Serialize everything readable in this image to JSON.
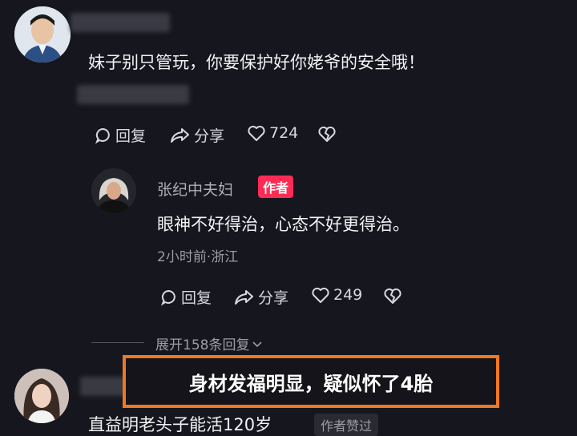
{
  "comment1": {
    "text": "妹子别只管玩，你要保护好你姥爷的安全哦！",
    "actions": {
      "reply": "回复",
      "share": "分享",
      "likes": "724"
    }
  },
  "reply1": {
    "author": "张纪中夫妇",
    "author_badge": "作者",
    "text": "眼神不好得治，心态不好更得治。",
    "meta": "2小时前·浙江",
    "actions": {
      "reply": "回复",
      "share": "分享",
      "likes": "249"
    }
  },
  "expand_replies": "展开158条回复",
  "caption_overlay": "身材发福明显，疑似怀了4胎",
  "comment2": {
    "text_partial": "直益明老头子能活120岁",
    "badge_partial": "作者赞过"
  },
  "colors": {
    "background": "#16161e",
    "author_badge_bg": "#fe2c55",
    "overlay_border": "#f07820"
  }
}
